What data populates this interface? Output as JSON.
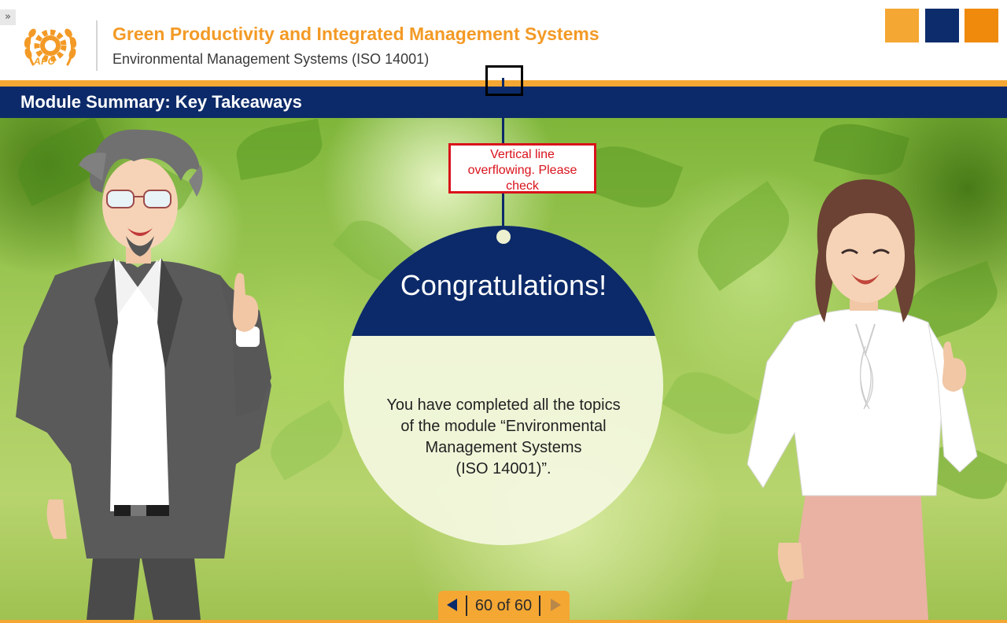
{
  "header": {
    "expand_glyph": "»",
    "logo_caption": "APO",
    "title": "Green Productivity and Integrated Management Systems",
    "subtitle": "Environmental Management Systems (ISO 14001)"
  },
  "module": {
    "title": "Module Summary: Key Takeaways"
  },
  "content": {
    "heading": "Congratulations!",
    "body_lines": [
      "You have completed all the topics",
      "of the module “Environmental",
      "Management Systems",
      "(ISO 14001)”."
    ]
  },
  "review_note": {
    "lines": [
      "Vertical line",
      "overflowing. Please",
      "check"
    ]
  },
  "navigation": {
    "counter": "60 of 60",
    "prev_icon": "triangle-left-icon",
    "next_icon": "triangle-right-icon",
    "current_page": 60,
    "total_pages": 60
  },
  "colors": {
    "brand_orange": "#f5a733",
    "title_orange": "#f39a26",
    "navy": "#0c2a69",
    "accent_orange": "#ef8a0c",
    "review_red": "#d9121b"
  }
}
